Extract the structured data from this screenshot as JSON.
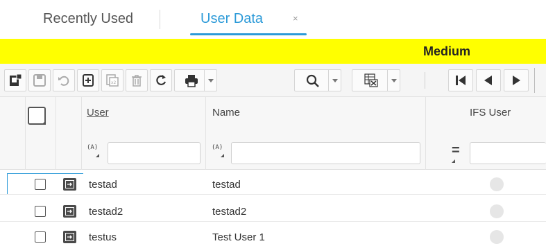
{
  "tabs": [
    {
      "label": "Recently Used",
      "active": false
    },
    {
      "label": "User Data",
      "active": true,
      "close": "×"
    }
  ],
  "banner": {
    "text": "Medium",
    "color": "#ffff00"
  },
  "toolbar": {
    "icons": [
      "new-record-icon",
      "save-icon",
      "undo-icon",
      "add-icon",
      "duplicate-icon",
      "delete-icon",
      "refresh-icon",
      "print-icon",
      "search-icon",
      "excel-export-icon",
      "first-record-icon",
      "previous-record-icon",
      "next-record-icon"
    ]
  },
  "grid": {
    "columns": {
      "user": "User",
      "name": "Name",
      "ifs_user": "IFS User"
    },
    "filters": {
      "user_tag": "(A)",
      "name_tag": "(A)",
      "ifs_tag": "="
    },
    "rows": [
      {
        "user": "testad",
        "name": "testad"
      },
      {
        "user": "testad2",
        "name": "testad2"
      },
      {
        "user": "testus",
        "name": "Test User 1"
      }
    ]
  },
  "colors": {
    "accent": "#2c9ad8",
    "banner": "#ffff00"
  }
}
